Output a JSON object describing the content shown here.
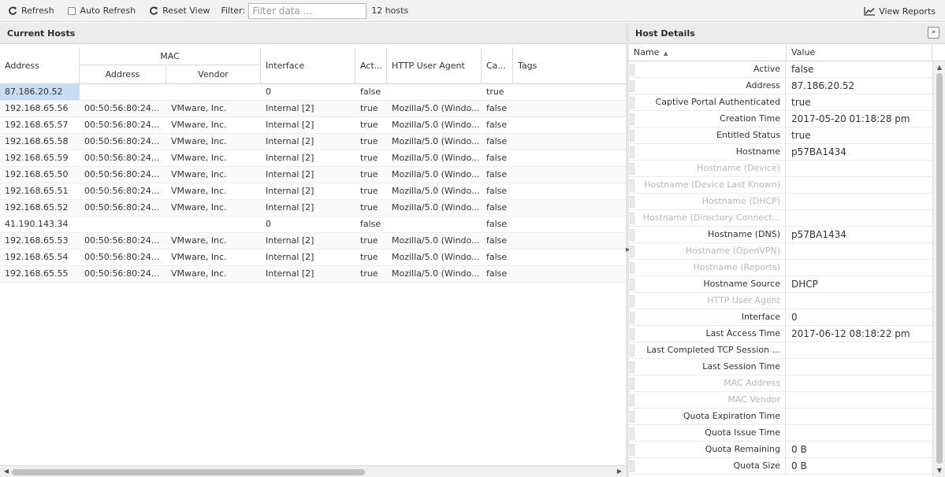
{
  "toolbar": {
    "refresh_label": "Refresh",
    "auto_refresh_label": "Auto Refresh",
    "reset_view_label": "Reset View",
    "filter_label": "Filter:",
    "filter_placeholder": "Filter data ...",
    "host_count": "12 hosts",
    "view_reports_label": "View Reports"
  },
  "current_hosts": {
    "title": "Current Hosts",
    "columns": {
      "address": "Address",
      "mac_group": "MAC",
      "mac_address": "Address",
      "mac_vendor": "Vendor",
      "interface": "Interface",
      "active": "Act...",
      "http_user_agent": "HTTP User Agent",
      "captive": "Ca...",
      "tags": "Tags"
    },
    "rows": [
      {
        "address": "87.186.20.52",
        "mac": "",
        "vendor": "",
        "interface": "0",
        "active": "false",
        "agent": "",
        "captive": "true"
      },
      {
        "address": "192.168.65.56",
        "mac": "00:50:56:80:24...",
        "vendor": "VMware, Inc.",
        "interface": "Internal [2]",
        "active": "true",
        "agent": "Mozilla/5.0 (Windo...",
        "captive": "false"
      },
      {
        "address": "192.168.65.57",
        "mac": "00:50:56:80:24...",
        "vendor": "VMware, Inc.",
        "interface": "Internal [2]",
        "active": "true",
        "agent": "Mozilla/5.0 (Windo...",
        "captive": "false"
      },
      {
        "address": "192.168.65.58",
        "mac": "00:50:56:80:24...",
        "vendor": "VMware, Inc.",
        "interface": "Internal [2]",
        "active": "true",
        "agent": "Mozilla/5.0 (Windo...",
        "captive": "false"
      },
      {
        "address": "192.168.65.59",
        "mac": "00:50:56:80:24...",
        "vendor": "VMware, Inc.",
        "interface": "Internal [2]",
        "active": "true",
        "agent": "Mozilla/5.0 (Windo...",
        "captive": "false"
      },
      {
        "address": "192.168.65.50",
        "mac": "00:50:56:80:24...",
        "vendor": "VMware, Inc.",
        "interface": "Internal [2]",
        "active": "true",
        "agent": "Mozilla/5.0 (Windo...",
        "captive": "false"
      },
      {
        "address": "192.168.65.51",
        "mac": "00:50:56:80:24...",
        "vendor": "VMware, Inc.",
        "interface": "Internal [2]",
        "active": "true",
        "agent": "Mozilla/5.0 (Windo...",
        "captive": "false"
      },
      {
        "address": "192.168.65.52",
        "mac": "00:50:56:80:24...",
        "vendor": "VMware, Inc.",
        "interface": "Internal [2]",
        "active": "true",
        "agent": "Mozilla/5.0 (Windo...",
        "captive": "false"
      },
      {
        "address": "41.190.143.34",
        "mac": "",
        "vendor": "",
        "interface": "0",
        "active": "false",
        "agent": "",
        "captive": "false"
      },
      {
        "address": "192.168.65.53",
        "mac": "00:50:56:80:24...",
        "vendor": "VMware, Inc.",
        "interface": "Internal [2]",
        "active": "true",
        "agent": "Mozilla/5.0 (Windo...",
        "captive": "false"
      },
      {
        "address": "192.168.65.54",
        "mac": "00:50:56:80:24...",
        "vendor": "VMware, Inc.",
        "interface": "Internal [2]",
        "active": "true",
        "agent": "Mozilla/5.0 (Windo...",
        "captive": "false"
      },
      {
        "address": "192.168.65.55",
        "mac": "00:50:56:80:24...",
        "vendor": "VMware, Inc.",
        "interface": "Internal [2]",
        "active": "true",
        "agent": "Mozilla/5.0 (Windo...",
        "captive": "false"
      }
    ]
  },
  "host_details": {
    "title": "Host Details",
    "col_name": "Name",
    "col_value": "Value",
    "rows": [
      {
        "name": "Active",
        "value": "false",
        "dim": false
      },
      {
        "name": "Address",
        "value": "87.186.20.52",
        "dim": false
      },
      {
        "name": "Captive Portal Authenticated",
        "value": "true",
        "dim": false
      },
      {
        "name": "Creation Time",
        "value": "2017-05-20 01:18:28 pm",
        "dim": false
      },
      {
        "name": "Entitled Status",
        "value": "true",
        "dim": false
      },
      {
        "name": "Hostname",
        "value": "p57BA1434",
        "dim": false
      },
      {
        "name": "Hostname (Device)",
        "value": "",
        "dim": true
      },
      {
        "name": "Hostname (Device Last Known)",
        "value": "",
        "dim": true
      },
      {
        "name": "Hostname (DHCP)",
        "value": "",
        "dim": true
      },
      {
        "name": "Hostname (Directory Connect...",
        "value": "",
        "dim": true
      },
      {
        "name": "Hostname (DNS)",
        "value": "p57BA1434",
        "dim": false
      },
      {
        "name": "Hostname (OpenVPN)",
        "value": "",
        "dim": true
      },
      {
        "name": "Hostname (Reports)",
        "value": "",
        "dim": true
      },
      {
        "name": "Hostname Source",
        "value": "DHCP",
        "dim": false
      },
      {
        "name": "HTTP User Agent",
        "value": "",
        "dim": true
      },
      {
        "name": "Interface",
        "value": "0",
        "dim": false
      },
      {
        "name": "Last Access Time",
        "value": "2017-06-12 08:18:22 pm",
        "dim": false
      },
      {
        "name": "Last Completed TCP Session ...",
        "value": "",
        "dim": false
      },
      {
        "name": "Last Session Time",
        "value": "",
        "dim": false
      },
      {
        "name": "MAC Address",
        "value": "",
        "dim": true
      },
      {
        "name": "MAC Vendor",
        "value": "",
        "dim": true
      },
      {
        "name": "Quota Expiration Time",
        "value": "",
        "dim": false
      },
      {
        "name": "Quota Issue Time",
        "value": "",
        "dim": false
      },
      {
        "name": "Quota Remaining",
        "value": "0 B",
        "dim": false
      },
      {
        "name": "Quota Size",
        "value": "0 B",
        "dim": false
      }
    ]
  }
}
